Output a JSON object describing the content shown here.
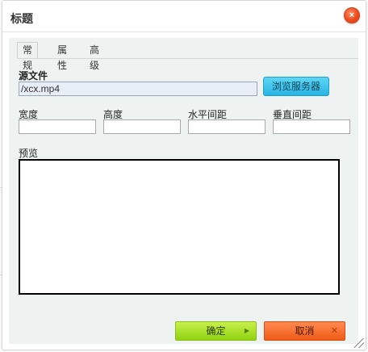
{
  "dialog": {
    "title": "标题",
    "close_icon": "×"
  },
  "tabs": [
    {
      "label": "常规",
      "active": true
    },
    {
      "label": "属性",
      "active": false
    },
    {
      "label": "高级",
      "active": false
    }
  ],
  "source": {
    "label": "源文件",
    "value": "/xcx.mp4",
    "browse_label": "浏览服务器"
  },
  "fields": {
    "width_label": "宽度",
    "width_value": "",
    "height_label": "高度",
    "height_value": "",
    "hspace_label": "水平间距",
    "hspace_value": "",
    "vspace_label": "垂直间距",
    "vspace_value": ""
  },
  "preview": {
    "label": "预览"
  },
  "footer": {
    "ok_label": "确定",
    "ok_icon": "▶",
    "cancel_label": "取消",
    "cancel_icon": "✕"
  },
  "colors": {
    "close_button": "#f04a1e",
    "browse_button": "#27b4e3",
    "ok_button": "#8fd20f",
    "cancel_button": "#ef5b16",
    "body_background": "#eef3f2"
  }
}
